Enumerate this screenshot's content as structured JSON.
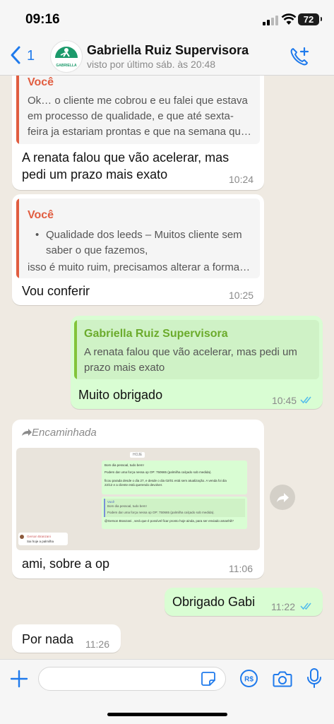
{
  "status_bar": {
    "time": "09:16",
    "battery": "72"
  },
  "header": {
    "back_count": "1",
    "contact_name": "Gabriella Ruiz Supervisora",
    "last_seen": "visto por último sáb. às 20:48",
    "avatar_brand": "GABRIELLA"
  },
  "messages": [
    {
      "quote_author": "Você",
      "quote_lines": [
        "Ok… o cliente me cobrou e eu falei que estava",
        "em processo de qualidade, e que até sexta-",
        "feira ja estariam prontas e que na semana qu…"
      ],
      "text_lines": [
        "A renata falou que vão acelerar, mas",
        "pedi um prazo mais exato"
      ],
      "time": "10:24"
    },
    {
      "quote_author": "Você",
      "quote_bullet": "•",
      "quote_lines": [
        "Qualidade dos leeds – Muitos cliente sem",
        "saber o que fazemos,",
        "isso é muito ruim, precisamos alterar a forma…"
      ],
      "text": "Vou conferir",
      "time": "10:25"
    },
    {
      "quote_author": "Gabriella Ruiz Supervisora",
      "quote_lines": [
        "A renata falou que vão acelerar, mas pedi um",
        "prazo mais exato"
      ],
      "text": "Muito obrigado",
      "time": "10:45"
    },
    {
      "forwarded_label": "Encaminhada",
      "thumbnail": {
        "day": "HOJE",
        "lines": [
          "Bom dia pessoal, tudo bem!",
          "Podem dar uma força nessa op OP: 750665 (palmilha calçado sob medida).",
          "ficou parada desde o dia 27, e desde o dia 02/01 está sem atualização. A venda foi dia",
          "22/12 e a cliente está querendo devolver."
        ],
        "quote_name": "Você",
        "quote_lines": [
          "Bom dia pessoal, tudo bem!",
          "Podem dar uma força nessa op OP: 750665 (palmilha calçado sob medida)."
        ],
        "reply": "@Gerson Branzani , será que é possível ficar pronto hoje ainda, para ser enviado amanhã?",
        "sender": "Gerson Branzani",
        "sender_text": "Sai hoje a palmilha"
      },
      "text": "ami, sobre a op",
      "time": "11:06"
    },
    {
      "text": "Obrigado Gabi",
      "time": "11:22"
    },
    {
      "text": "Por nada",
      "time": "11:26"
    }
  ],
  "colors": {
    "read_ticks": "#53bdeb",
    "accent_blue": "#1f7aec",
    "quote_you": "#e15d40",
    "quote_other": "#6bab2c",
    "outgoing_bubble": "#d9fdd3"
  },
  "icons": [
    "back-chevron",
    "add-call",
    "forward-arrow",
    "share",
    "plus",
    "sticker",
    "pix-payment",
    "camera",
    "microphone"
  ]
}
